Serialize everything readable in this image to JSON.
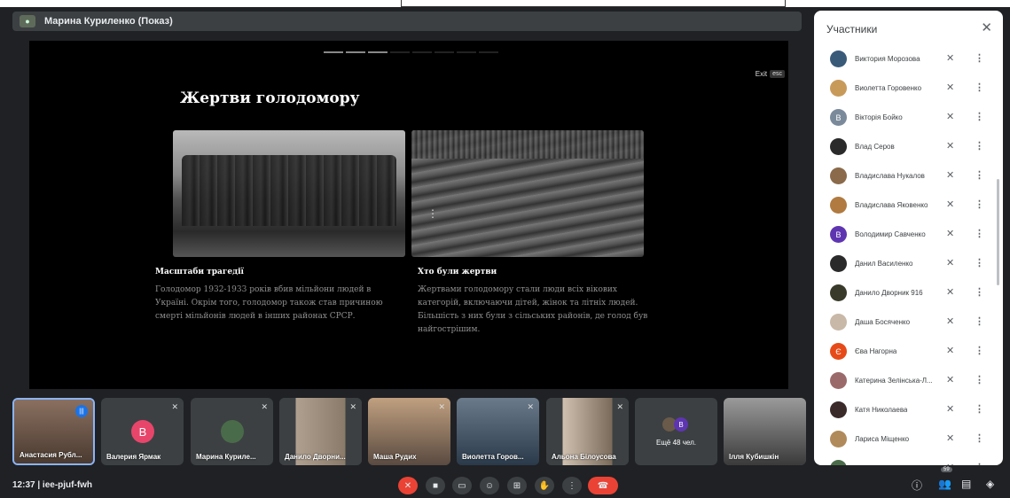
{
  "presenter_bar": {
    "title": "Марина Куриленко (Показ)"
  },
  "slide": {
    "exit_label": "Exit",
    "esc_label": "esc",
    "title": "Жертви голодомору",
    "col1_heading": "Масштаби трагедії",
    "col1_text": "Голодомор 1932-1933 років вбив мільйони людей в Україні. Окрім того, голодомор також став причиною смерті мільйонів людей в інших районах СРСР.",
    "col2_heading": "Хто були жертви",
    "col2_text": "Жертвами голодомору стали люди всіх вікових категорій, включаючи дітей, жінок та літніх людей. Більшість з них були з сільських районів, де голод був найгострішим."
  },
  "tiles": [
    {
      "name": "Анастасия Рубл...",
      "color": "#6b5a52"
    },
    {
      "name": "Валерия Ярмак",
      "initial": "В",
      "color": "#e8456b"
    },
    {
      "name": "Марина Куриле...",
      "initial": "",
      "color": "#4a6b4a"
    },
    {
      "name": "Данило Дворни...",
      "color": "#8a7a6a"
    },
    {
      "name": "Маша Рудих",
      "color": "#5a4a40"
    },
    {
      "name": "Виолетта Горов...",
      "color": "#4a5a6a"
    },
    {
      "name": "Альона Білоусова",
      "color": "#7a6a5a"
    },
    {
      "more_label": "Ещё 48 чел.",
      "initial": "В"
    },
    {
      "name": "Ілля Кубишкін",
      "color": "#6a6a6a"
    }
  ],
  "bottom": {
    "meeting": "12:37  |  iee-pjuf-fwh",
    "participants_count": "59"
  },
  "panel": {
    "title": "Участники",
    "close": "✕",
    "participants": [
      {
        "name": "Виктория Морозова",
        "initial": "",
        "color": "#3a5a7a"
      },
      {
        "name": "Виолетта Горовенко",
        "initial": "",
        "color": "#c89a5a"
      },
      {
        "name": "Вікторія Бойко",
        "initial": "В",
        "color": "#7a8a9a"
      },
      {
        "name": "Влад Серов",
        "initial": "",
        "color": "#2a2a2a"
      },
      {
        "name": "Владислава Нукалов",
        "initial": "",
        "color": "#8a6a4a"
      },
      {
        "name": "Владислава Яковенко",
        "initial": "",
        "color": "#b07a40"
      },
      {
        "name": "Володимир Савченко",
        "initial": "В",
        "color": "#5e35b1"
      },
      {
        "name": "Данил Василенко",
        "initial": "",
        "color": "#2a2a2a"
      },
      {
        "name": "Данило Дворник 916",
        "initial": "",
        "color": "#3a3a2a"
      },
      {
        "name": "Даша Босяченко",
        "initial": "",
        "color": "#c8b8a8"
      },
      {
        "name": "Єва Нагорна",
        "initial": "Є",
        "color": "#e64a19"
      },
      {
        "name": "Катерина Зелінська-Л...",
        "initial": "",
        "color": "#9a6a6a"
      },
      {
        "name": "Катя Николаева",
        "initial": "",
        "color": "#3a2a2a"
      },
      {
        "name": "Лариса Міщенко",
        "initial": "",
        "color": "#b08a5a"
      },
      {
        "name": "Марина Куриленко",
        "initial": "",
        "color": "#4a6b4a"
      }
    ]
  }
}
